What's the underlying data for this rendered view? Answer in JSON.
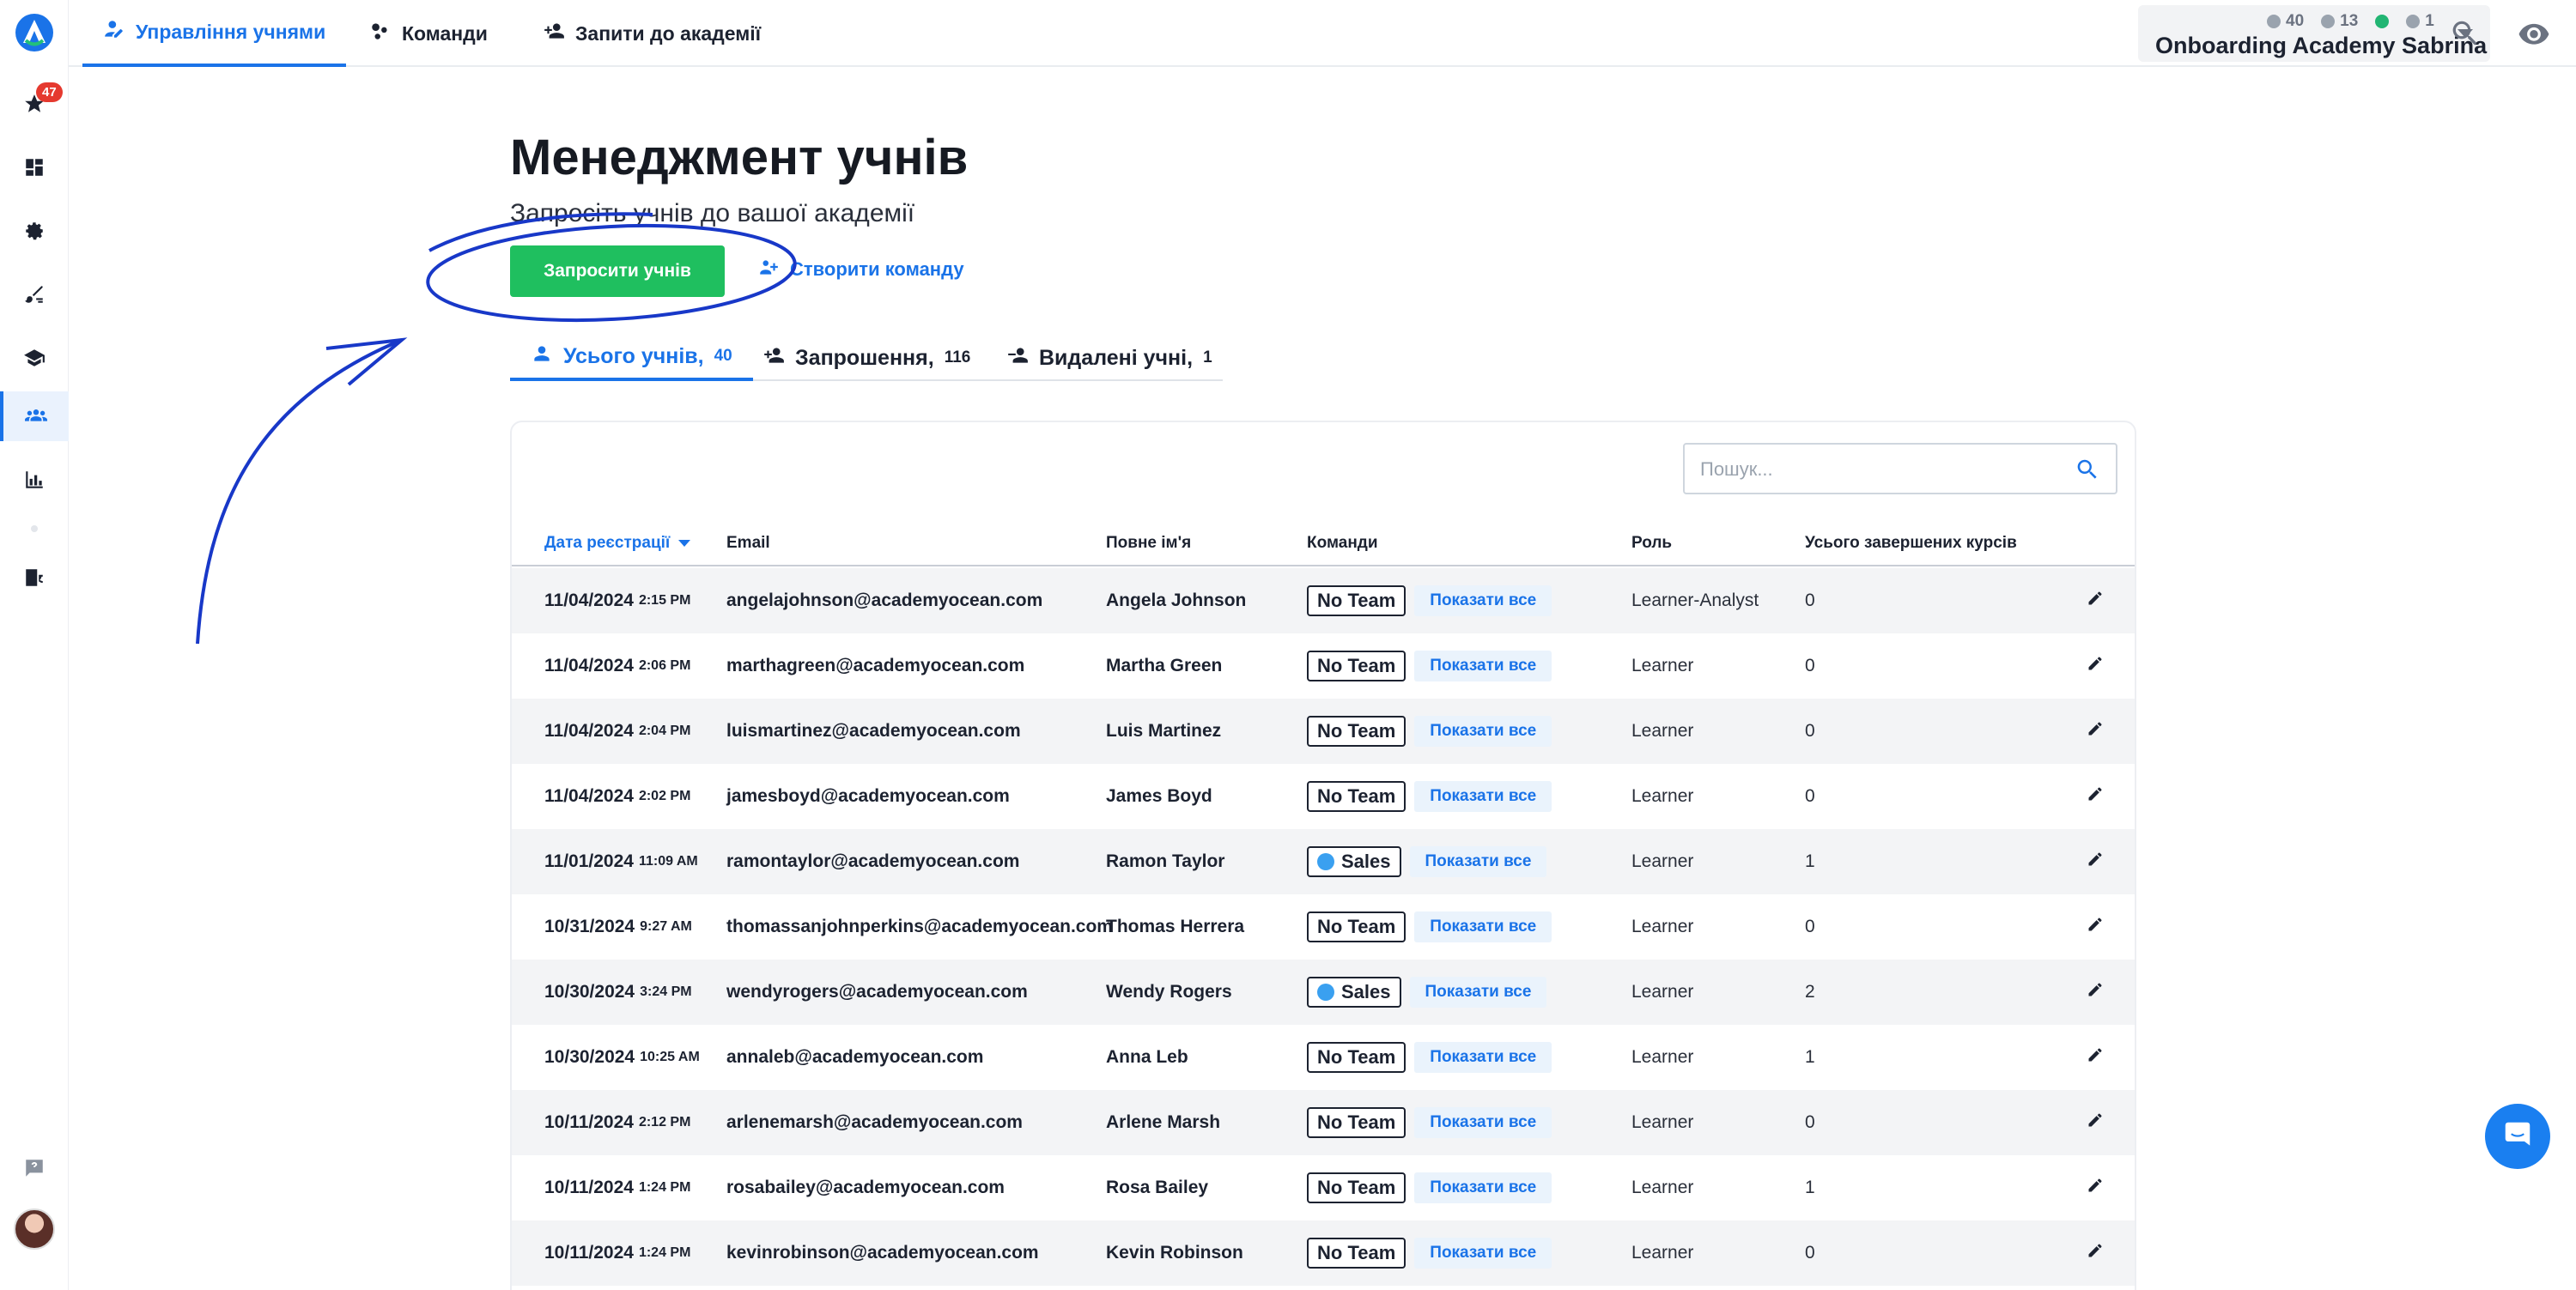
{
  "sidebar": {
    "notification_count": "47",
    "items": [
      {
        "name": "favorites",
        "icon": "star-icon"
      },
      {
        "name": "dashboard",
        "icon": "dashboard-icon"
      },
      {
        "name": "settings",
        "icon": "gear-icon"
      },
      {
        "name": "design",
        "icon": "brush-icon"
      },
      {
        "name": "academy",
        "icon": "graduation-cap-icon"
      },
      {
        "name": "learners",
        "icon": "group-icon"
      },
      {
        "name": "reports",
        "icon": "bar-chart-icon"
      },
      {
        "name": "translations",
        "icon": "translate-icon"
      }
    ]
  },
  "topnav": {
    "tabs": [
      {
        "label": "Управління учнями",
        "active": true
      },
      {
        "label": "Команди",
        "active": false
      },
      {
        "label": "Запити до академії",
        "active": false
      }
    ]
  },
  "account": {
    "name": "Onboarding Academy Sabrina",
    "stat_learners": "40",
    "stat_courses": "13",
    "stat_third": "1"
  },
  "header": {
    "title": "Менеджмент учнів",
    "subtitle": "Запросіть учнів до вашої академії",
    "invite_button": "Запросити учнів",
    "create_team_link": "Створити команду"
  },
  "subtabs": [
    {
      "label": "Усього учнів,",
      "count": "40",
      "active": true
    },
    {
      "label": "Запрошення,",
      "count": "116",
      "active": false
    },
    {
      "label": "Видалені учні,",
      "count": "1",
      "active": false
    }
  ],
  "search": {
    "placeholder": "Пошук..."
  },
  "table": {
    "columns": {
      "date": "Дата реєстрації",
      "email": "Email",
      "name": "Повне ім'я",
      "teams": "Команди",
      "role": "Роль",
      "completed": "Усього завершених курсів"
    },
    "show_all_label": "Показати все",
    "rows": [
      {
        "date": "11/04/2024",
        "time": "2:15 PM",
        "email": "angelajohnson@academyocean.com",
        "name": "Angela Johnson",
        "team": "No Team",
        "team_dot": false,
        "role": "Learner-Analyst",
        "completed": "0"
      },
      {
        "date": "11/04/2024",
        "time": "2:06 PM",
        "email": "marthagreen@academyocean.com",
        "name": "Martha Green",
        "team": "No Team",
        "team_dot": false,
        "role": "Learner",
        "completed": "0"
      },
      {
        "date": "11/04/2024",
        "time": "2:04 PM",
        "email": "luismartinez@academyocean.com",
        "name": "Luis Martinez",
        "team": "No Team",
        "team_dot": false,
        "role": "Learner",
        "completed": "0"
      },
      {
        "date": "11/04/2024",
        "time": "2:02 PM",
        "email": "jamesboyd@academyocean.com",
        "name": "James Boyd",
        "team": "No Team",
        "team_dot": false,
        "role": "Learner",
        "completed": "0"
      },
      {
        "date": "11/01/2024",
        "time": "11:09 AM",
        "email": "ramontaylor@academyocean.com",
        "name": "Ramon Taylor",
        "team": "Sales",
        "team_dot": true,
        "role": "Learner",
        "completed": "1"
      },
      {
        "date": "10/31/2024",
        "time": "9:27 AM",
        "email": "thomassanjohnperkins@academyocean.com",
        "name": "Thomas Herrera",
        "team": "No Team",
        "team_dot": false,
        "role": "Learner",
        "completed": "0"
      },
      {
        "date": "10/30/2024",
        "time": "3:24 PM",
        "email": "wendyrogers@academyocean.com",
        "name": "Wendy Rogers",
        "team": "Sales",
        "team_dot": true,
        "role": "Learner",
        "completed": "2"
      },
      {
        "date": "10/30/2024",
        "time": "10:25 AM",
        "email": "annaleb@academyocean.com",
        "name": "Anna Leb",
        "team": "No Team",
        "team_dot": false,
        "role": "Learner",
        "completed": "1"
      },
      {
        "date": "10/11/2024",
        "time": "2:12 PM",
        "email": "arlenemarsh@academyocean.com",
        "name": "Arlene Marsh",
        "team": "No Team",
        "team_dot": false,
        "role": "Learner",
        "completed": "0"
      },
      {
        "date": "10/11/2024",
        "time": "1:24 PM",
        "email": "rosabailey@academyocean.com",
        "name": "Rosa Bailey",
        "team": "No Team",
        "team_dot": false,
        "role": "Learner",
        "completed": "1"
      },
      {
        "date": "10/11/2024",
        "time": "1:24 PM",
        "email": "kevinrobinson@academyocean.com",
        "name": "Kevin Robinson",
        "team": "No Team",
        "team_dot": false,
        "role": "Learner",
        "completed": "0"
      }
    ]
  },
  "colors": {
    "accent": "#1a73e8",
    "primary_button": "#1fbf5f",
    "annotation": "#1838c8",
    "badge": "#e5392f"
  }
}
